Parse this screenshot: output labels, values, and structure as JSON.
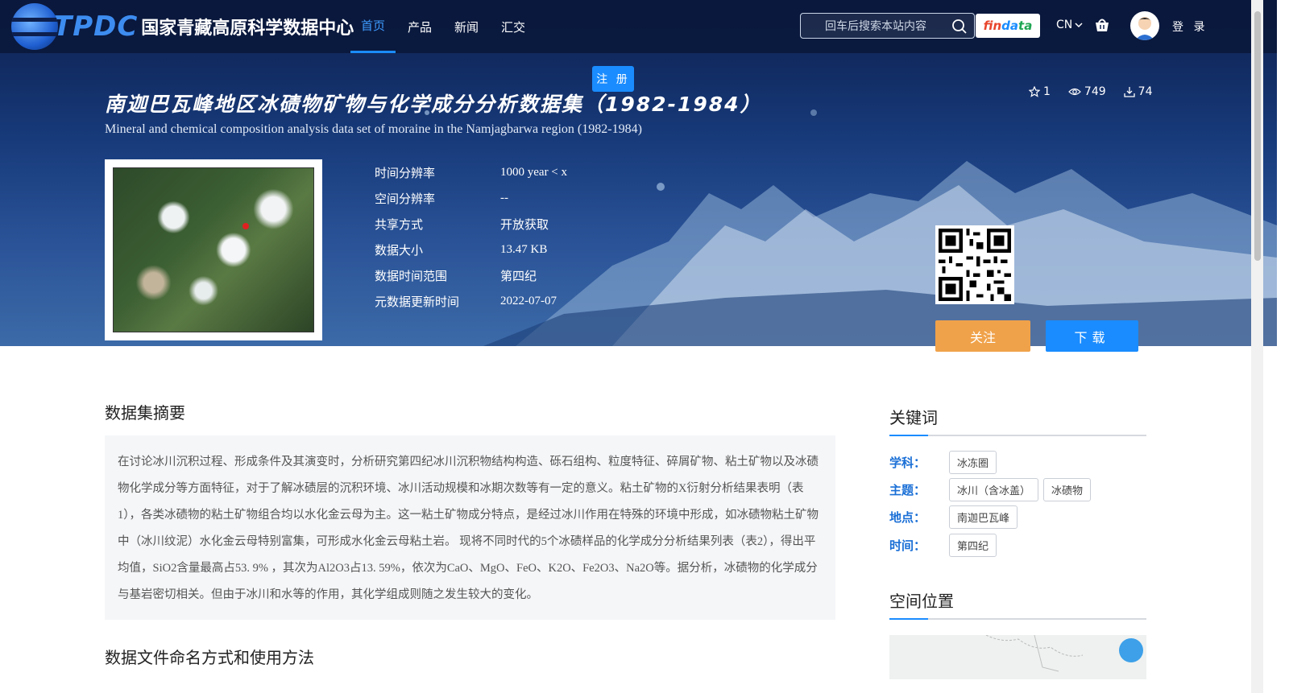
{
  "brand": {
    "logo_text": "TPDC",
    "name": "国家青藏高原科学数据中心"
  },
  "nav": {
    "items": [
      "首页",
      "产品",
      "新闻",
      "汇交"
    ]
  },
  "search": {
    "placeholder": "回车后搜索本站内容",
    "value": ""
  },
  "findata": {
    "part1": "fin",
    "part2": "da",
    "part3": "ta"
  },
  "lang": "CN",
  "login_label": "登 录",
  "register_label": "注 册",
  "dataset": {
    "title_cn": "南迦巴瓦峰地区冰碛物矿物与化学成分分析数据集（1982-1984）",
    "title_en": "Mineral and chemical composition analysis data set of moraine in the Namjagbarwa region (1982-1984)",
    "stars": "1",
    "views": "749",
    "downloads": "74",
    "meta": [
      {
        "key": "时间分辨率",
        "value": "1000 year < x"
      },
      {
        "key": "空间分辨率",
        "value": "--"
      },
      {
        "key": "共享方式",
        "value": "开放获取"
      },
      {
        "key": "数据大小",
        "value": "13.47 KB"
      },
      {
        "key": "数据时间范围",
        "value": "第四纪"
      },
      {
        "key": "元数据更新时间",
        "value": "2022-07-07"
      }
    ],
    "follow_label": "关注",
    "download_label": "下载"
  },
  "abstract": {
    "heading": "数据集摘要",
    "text": "在讨论冰川沉积过程、形成条件及其演变时，分析研究第四纪冰川沉积物结构构造、砾石组构、粒度特征、碎屑矿物、粘土矿物以及冰碛物化学成分等方面特征，对于了解冰碛层的沉积环境、冰川活动规模和冰期次数等有一定的意义。粘土矿物的X衍射分析结果表明（表1），各类冰碛物的粘土矿物组合均以水化金云母为主。这一粘土矿物成分特点，是经过冰川作用在特殊的环境中形成，如冰碛物粘土矿物中（冰川纹泥）水化金云母特别富集，可形成水化金云母粘土岩。 现将不同时代的5个冰碛样品的化学成分分析结果列表（表2），得出平均值，SiO2含量最高占53. 9% ，其次为Al2O3占13. 59%，依次为CaO、MgO、FeO、K2O、Fe2O3、Na2O等。据分析，冰碛物的化学成分与基岩密切相关。但由于冰川和水等的作用，其化学组成则随之发生较大的变化。"
  },
  "usage": {
    "heading": "数据文件命名方式和使用方法"
  },
  "keywords": {
    "heading": "关键词",
    "rows": [
      {
        "label": "学科：",
        "tags": [
          "冰冻圈"
        ]
      },
      {
        "label": "主题：",
        "tags": [
          "冰川（含冰盖）",
          "冰碛物"
        ]
      },
      {
        "label": "地点：",
        "tags": [
          "南迦巴瓦峰"
        ]
      },
      {
        "label": "时间：",
        "tags": [
          "第四纪"
        ]
      }
    ]
  },
  "location": {
    "heading": "空间位置"
  },
  "colors": {
    "accent": "#1a8cff",
    "follow": "#f0a24a",
    "keyword_label": "#1a6fd6"
  }
}
